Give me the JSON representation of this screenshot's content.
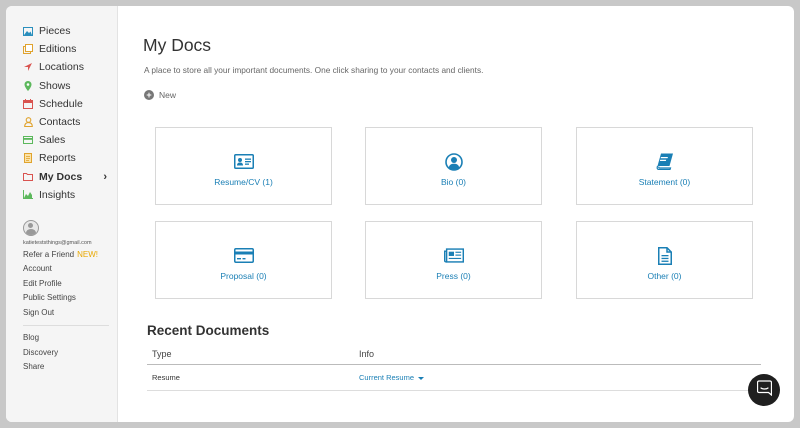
{
  "sidebar": {
    "nav": [
      {
        "label": "Pieces",
        "icon": "image-icon",
        "color": "#2a8fbd"
      },
      {
        "label": "Editions",
        "icon": "editions-icon",
        "color": "#e0a32e"
      },
      {
        "label": "Locations",
        "icon": "location-arrow-icon",
        "color": "#d9534f"
      },
      {
        "label": "Shows",
        "icon": "map-pin-icon",
        "color": "#5cb85c"
      },
      {
        "label": "Schedule",
        "icon": "calendar-icon",
        "color": "#d9534f"
      },
      {
        "label": "Contacts",
        "icon": "user-icon",
        "color": "#e0a32e"
      },
      {
        "label": "Sales",
        "icon": "credit-card-icon",
        "color": "#5cb85c"
      },
      {
        "label": "Reports",
        "icon": "report-icon",
        "color": "#e0a32e"
      },
      {
        "label": "My Docs",
        "icon": "folder-icon",
        "color": "#d9534f"
      },
      {
        "label": "Insights",
        "icon": "area-chart-icon",
        "color": "#5cb85c"
      }
    ],
    "email": "katieteststhings@gmail.com",
    "account_links": {
      "refer": "Refer a Friend",
      "refer_badge": "NEW!",
      "account": "Account",
      "edit_profile": "Edit Profile",
      "public_settings": "Public Settings",
      "sign_out": "Sign Out"
    },
    "secondary_links": [
      "Blog",
      "Discovery",
      "Share"
    ]
  },
  "main": {
    "title": "My Docs",
    "subtitle": "A place to store all your important documents. One click sharing to your contacts and clients.",
    "new_label": "New",
    "cards": [
      {
        "label": "Resume/CV (1)",
        "icon": "id-card-icon"
      },
      {
        "label": "Bio (0)",
        "icon": "user-circle-icon"
      },
      {
        "label": "Statement (0)",
        "icon": "book-icon"
      },
      {
        "label": "Proposal (0)",
        "icon": "credit-card-icon"
      },
      {
        "label": "Press (0)",
        "icon": "newspaper-icon"
      },
      {
        "label": "Other (0)",
        "icon": "file-text-icon"
      }
    ],
    "recent": {
      "title": "Recent Documents",
      "headers": {
        "type": "Type",
        "info": "Info"
      },
      "rows": [
        {
          "type": "Resume",
          "info": "Current Resume"
        }
      ]
    }
  },
  "colors": {
    "accent": "#1a7fb5"
  }
}
